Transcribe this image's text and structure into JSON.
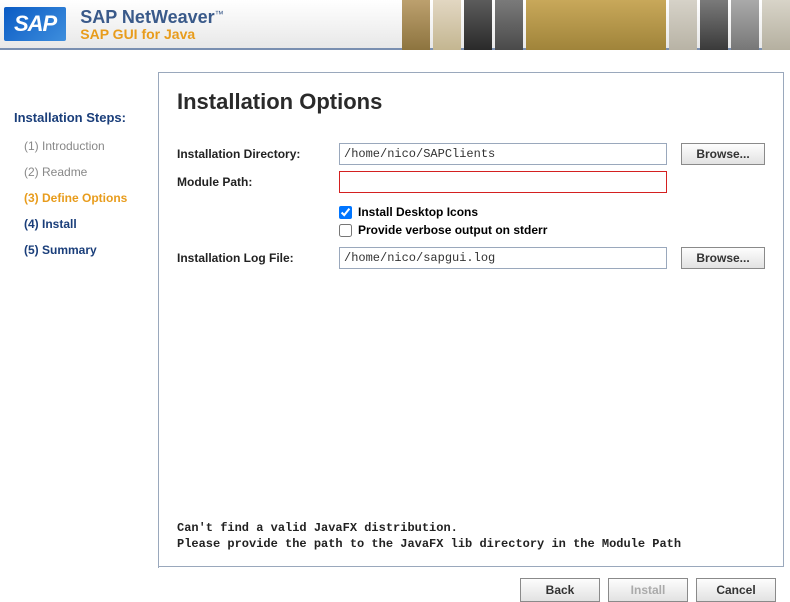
{
  "header": {
    "logo_text": "SAP",
    "title": "SAP NetWeaver",
    "subtitle": "SAP GUI for Java"
  },
  "sidebar": {
    "title": "Installation Steps:",
    "steps": [
      {
        "label": "(1) Introduction",
        "state": "past"
      },
      {
        "label": "(2) Readme",
        "state": "past"
      },
      {
        "label": "(3) Define Options",
        "state": "active"
      },
      {
        "label": "(4) Install",
        "state": "future"
      },
      {
        "label": "(5) Summary",
        "state": "future"
      }
    ]
  },
  "panel": {
    "title": "Installation Options",
    "labels": {
      "install_dir": "Installation Directory:",
      "module_path": "Module Path:",
      "log_file": "Installation Log File:"
    },
    "values": {
      "install_dir": "/home/nico/SAPClients",
      "module_path": "",
      "log_file": "/home/nico/sapgui.log"
    },
    "checkboxes": {
      "desktop_icons": {
        "label": "Install Desktop Icons",
        "checked": true
      },
      "verbose": {
        "label": "Provide verbose output on stderr",
        "checked": false
      }
    },
    "browse_label": "Browse...",
    "message_line1": "Can't find a valid JavaFX distribution.",
    "message_line2": "Please provide the path to the JavaFX lib directory in the Module Path"
  },
  "buttons": {
    "back": "Back",
    "install": "Install",
    "cancel": "Cancel"
  }
}
